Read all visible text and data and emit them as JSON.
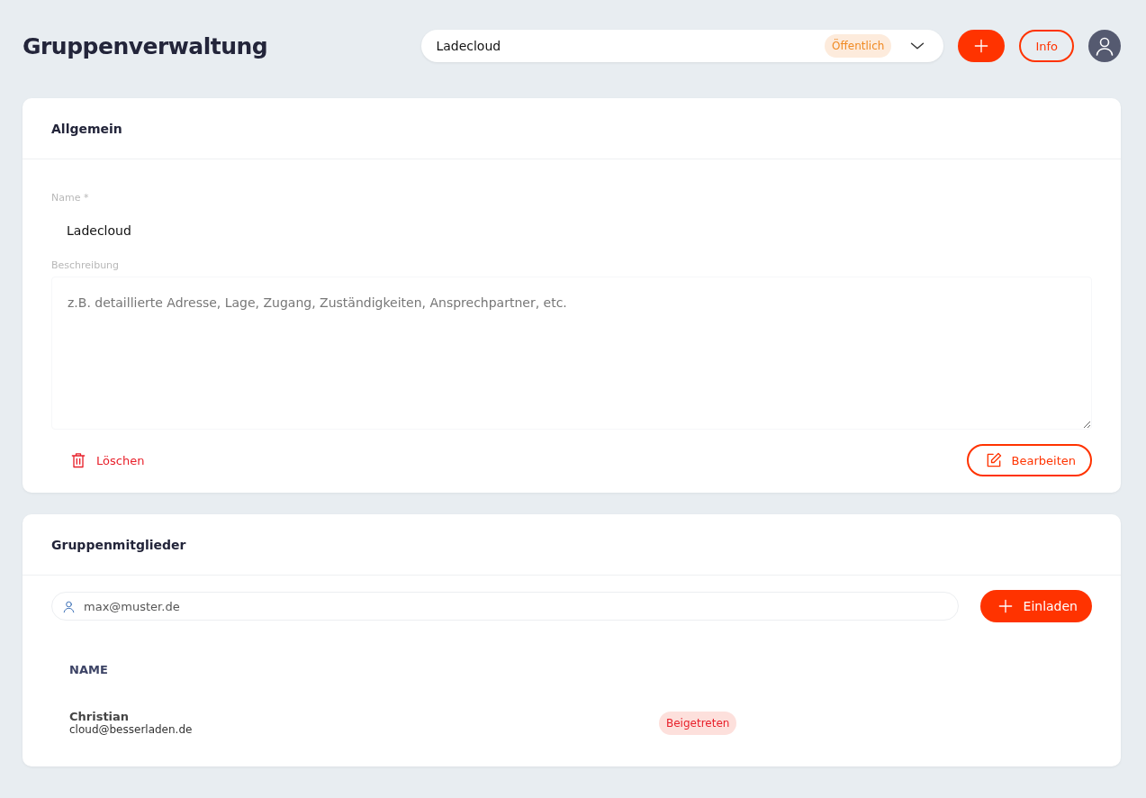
{
  "page_title": "Gruppenverwaltung",
  "group_select": {
    "value": "Ladecloud",
    "badge": "Öffentlich"
  },
  "header_buttons": {
    "info": "Info"
  },
  "general": {
    "title": "Allgemein",
    "name_label": "Name *",
    "name_value": "Ladecloud",
    "description_label": "Beschreibung",
    "description_placeholder": "z.B. detaillierte Adresse, Lage, Zugang, Zuständigkeiten, Ansprechpartner, etc.",
    "delete": "Löschen",
    "edit": "Bearbeiten"
  },
  "members": {
    "title": "Gruppenmitglieder",
    "invite_placeholder": "max@muster.de",
    "invite": "Einladen",
    "columns": [
      "NAME"
    ],
    "rows": [
      {
        "name": "Christian",
        "email": "cloud@besserladen.de",
        "status": "Beigetreten"
      }
    ]
  }
}
